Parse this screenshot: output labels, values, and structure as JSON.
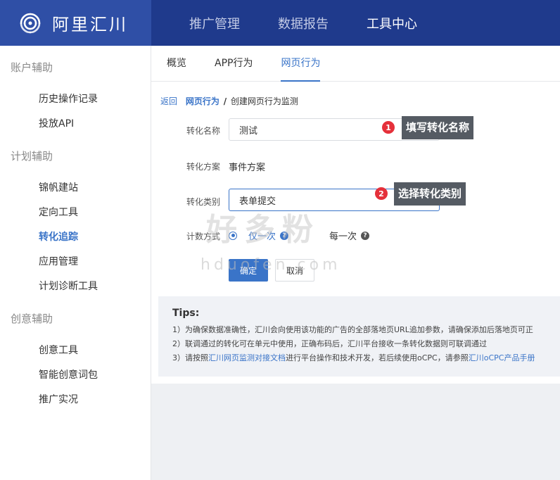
{
  "brand": {
    "name": "阿里汇川"
  },
  "topnav": [
    {
      "label": "推广管理"
    },
    {
      "label": "数据报告"
    },
    {
      "label": "工具中心"
    }
  ],
  "sidebar": {
    "group1": "账户辅助",
    "item1": "历史操作记录",
    "item2": "投放API",
    "group2": "计划辅助",
    "item3": "锦帆建站",
    "item4": "定向工具",
    "item5": "转化追踪",
    "item6": "应用管理",
    "item7": "计划诊断工具",
    "group3": "创意辅助",
    "item8": "创意工具",
    "item9": "智能创意词包",
    "item10": "推广实况"
  },
  "tabs": [
    {
      "label": "概览"
    },
    {
      "label": "APP行为"
    },
    {
      "label": "网页行为"
    }
  ],
  "breadcrumb": {
    "back": "返回",
    "section": "网页行为",
    "separator": "/",
    "current": "创建网页行为监测"
  },
  "form": {
    "name_label": "转化名称",
    "name_value": "测试",
    "scheme_label": "转化方案",
    "scheme_value": "事件方案",
    "category_label": "转化类别",
    "category_value": "表单提交",
    "count_label": "计数方式",
    "count_option1": "仅一次",
    "count_option2": "每一次",
    "help_glyph": "?",
    "confirm_label": "确定",
    "cancel_label": "取消"
  },
  "tips": {
    "title": "Tips:",
    "line1": "1）为确保数据准确性，汇川会向使用该功能的广告的全部落地页URL追加参数，请确保添加后落地页可正",
    "line2": "2）联调通过的转化可在单元中使用，正确布码后，汇川平台接收一条转化数据则可联调通过",
    "line3_pre": "3）请按照",
    "line3_link1": "汇川网页监测对接文档",
    "line3_mid": "进行平台操作和技术开发，若后续使用oCPC，请参照",
    "line3_link2": "汇川oCPC产品手册"
  },
  "annotations": {
    "badge1": "1",
    "callout1": "填写转化名称",
    "badge2": "2",
    "callout2": "选择转化类别"
  },
  "watermark": {
    "big": "好多粉",
    "small": "hduofen.com"
  },
  "colors": {
    "topbar": "#1f3a8c",
    "logo_bg": "#2f4fa6",
    "accent": "#3a74c8",
    "badge": "#e5303a",
    "callout": "#555b63"
  }
}
